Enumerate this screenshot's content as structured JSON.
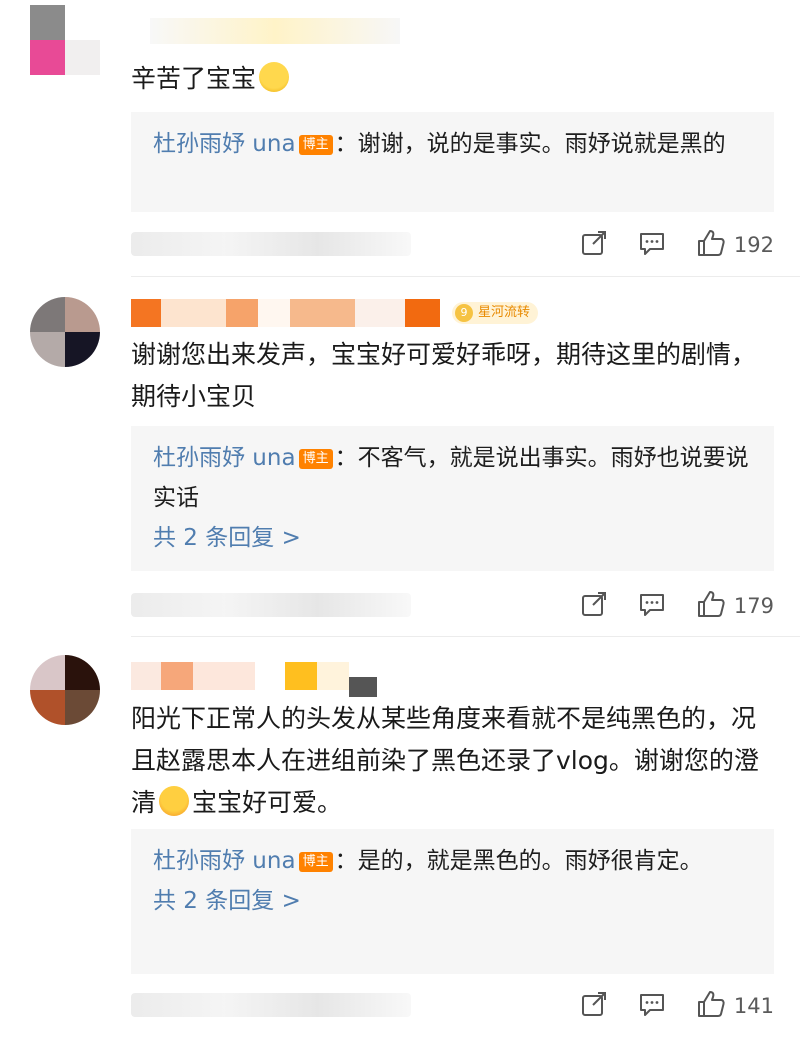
{
  "comments": [
    {
      "text": "辛苦了宝宝",
      "emoji": "crying-face-emoji",
      "reply": {
        "author": "杜孙雨妤 una",
        "badge": "博主",
        "text": "：谢谢，说的是事实。雨妤说就是黑的"
      },
      "likes": "192"
    },
    {
      "fan_badge": "星河流转",
      "fan_level": "9",
      "text": "谢谢您出来发声，宝宝好可爱好乖呀，期待这里的剧情，期待小宝贝",
      "reply": {
        "author": "杜孙雨妤 una",
        "badge": "博主",
        "text": "：不客气，就是说出事实。雨妤也说要说实话",
        "more": "共 2 条回复 >"
      },
      "likes": "179"
    },
    {
      "text_before": "阳光下正常人的头发从某些角度来看就不是纯黑色的，况且赵露思本人在进组前染了黑色还录了vlog。谢谢您的澄清",
      "emoji": "blowing-kiss-emoji",
      "text_after": "宝宝好可爱。",
      "reply": {
        "author": "杜孙雨妤 una",
        "badge": "博主",
        "text": "：是的，就是黑色的。雨妤很肯定。",
        "more": "共 2 条回复 >"
      },
      "likes": "141"
    }
  ],
  "colors": {
    "link": "#507daf",
    "badge": "#ff8200",
    "reply_bg": "#f6f6f6"
  }
}
